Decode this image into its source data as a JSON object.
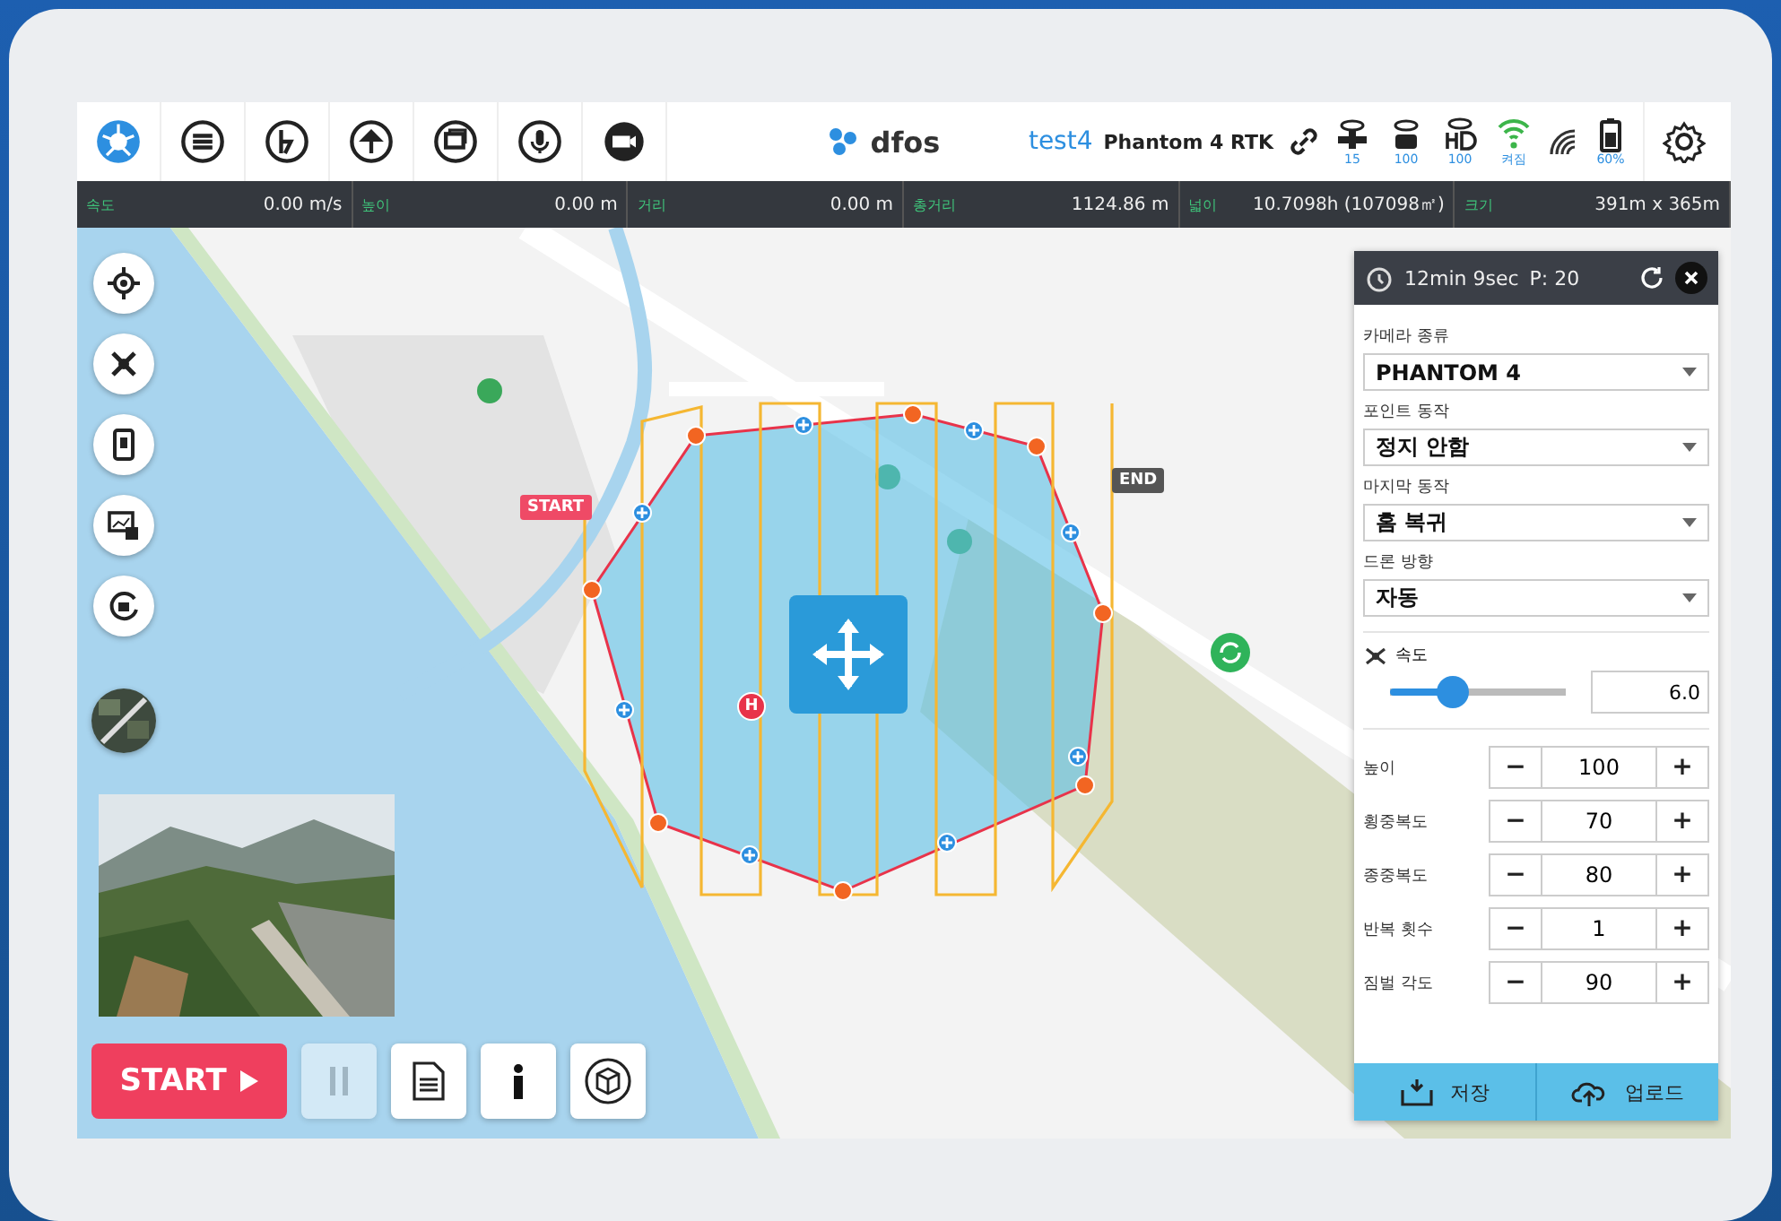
{
  "toolbar": {
    "logo": "dfos",
    "user": "test4",
    "model": "Phantom 4 RTK",
    "indicators": [
      "15",
      "100",
      "100",
      "켜짐"
    ],
    "battery": "60%"
  },
  "stats": [
    {
      "label": "속도",
      "value": "0.00 m/s"
    },
    {
      "label": "높이",
      "value": "0.00 m"
    },
    {
      "label": "거리",
      "value": "0.00 m"
    },
    {
      "label": "총거리",
      "value": "1124.86 m"
    },
    {
      "label": "넓이",
      "value": "10.7098h (107098㎡)"
    },
    {
      "label": "크기",
      "value": "391m x 365m"
    }
  ],
  "map": {
    "start_label": "START",
    "end_label": "END",
    "home_marker": "H"
  },
  "controls": {
    "start": "START",
    "pause_disabled": true
  },
  "panel": {
    "duration": "12min 9sec",
    "points": "P: 20",
    "selects": [
      {
        "label": "카메라 종류",
        "value": "PHANTOM 4"
      },
      {
        "label": "포인트 동작",
        "value": "정지 안함"
      },
      {
        "label": "마지막 동작",
        "value": "홈 복귀"
      },
      {
        "label": "드론 방향",
        "value": "자동"
      }
    ],
    "speed": {
      "label": "속도",
      "level": 0.36,
      "value": "6.0"
    },
    "steppers": [
      {
        "label": "높이",
        "value": "100",
        "minus": "−",
        "plus": "+"
      },
      {
        "label": "횡중복도",
        "value": "70",
        "minus": "−",
        "plus": "+"
      },
      {
        "label": "종중복도",
        "value": "80",
        "minus": "−",
        "plus": "+"
      },
      {
        "label": "반복 횟수",
        "value": "1",
        "minus": "−",
        "plus": "+"
      },
      {
        "label": "짐벌 각도",
        "value": "90",
        "minus": "−",
        "plus": "+"
      }
    ],
    "buttons": [
      "저장",
      "업로드"
    ]
  }
}
